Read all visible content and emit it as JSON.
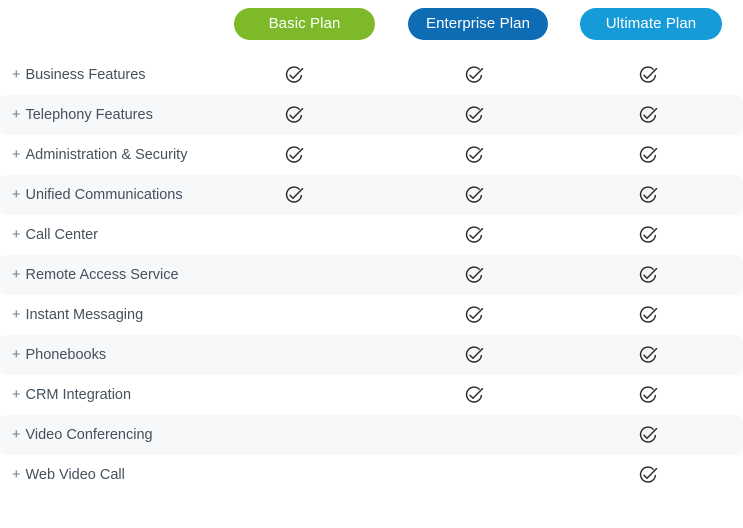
{
  "plans": [
    {
      "id": "basic",
      "label": "Basic Plan",
      "color": "#7db928"
    },
    {
      "id": "enterprise",
      "label": "Enterprise Plan",
      "color": "#0e6cb5"
    },
    {
      "id": "ultimate",
      "label": "Ultimate Plan",
      "color": "#159cd8"
    }
  ],
  "expand_symbol": "+",
  "icons": {
    "check": "check-circle-icon"
  },
  "features": [
    {
      "label": "Business Features",
      "basic": true,
      "enterprise": true,
      "ultimate": true
    },
    {
      "label": "Telephony Features",
      "basic": true,
      "enterprise": true,
      "ultimate": true
    },
    {
      "label": "Administration & Security",
      "basic": true,
      "enterprise": true,
      "ultimate": true
    },
    {
      "label": "Unified Communications",
      "basic": true,
      "enterprise": true,
      "ultimate": true
    },
    {
      "label": "Call Center",
      "basic": false,
      "enterprise": true,
      "ultimate": true
    },
    {
      "label": "Remote Access Service",
      "basic": false,
      "enterprise": true,
      "ultimate": true
    },
    {
      "label": "Instant Messaging",
      "basic": false,
      "enterprise": true,
      "ultimate": true
    },
    {
      "label": "Phonebooks",
      "basic": false,
      "enterprise": true,
      "ultimate": true
    },
    {
      "label": "CRM Integration",
      "basic": false,
      "enterprise": true,
      "ultimate": true
    },
    {
      "label": "Video Conferencing",
      "basic": false,
      "enterprise": false,
      "ultimate": true
    },
    {
      "label": "Web Video Call",
      "basic": false,
      "enterprise": false,
      "ultimate": true
    }
  ]
}
